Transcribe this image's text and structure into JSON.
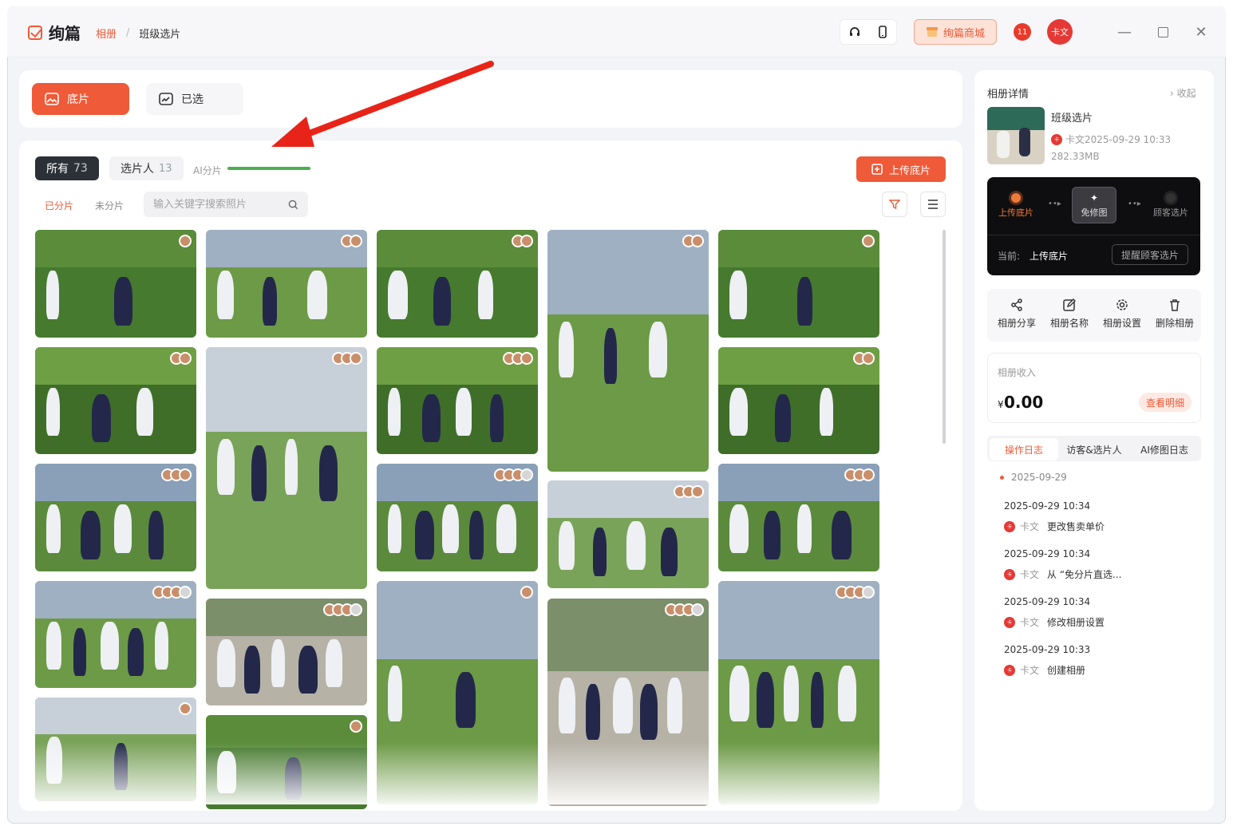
{
  "app": {
    "name": "绚篇",
    "breadcrumb": [
      "相册",
      "班级选片"
    ]
  },
  "titlebar": {
    "shop_label": "绚篇商城",
    "badge_label": "11",
    "user_initials": "卡文"
  },
  "tabs": [
    {
      "label": "底片",
      "active": true
    },
    {
      "label": "已选",
      "active": false
    }
  ],
  "filters": {
    "all_label": "所有",
    "all_count": "73",
    "pickers_label": "选片人",
    "pickers_count": "13",
    "ai_label": "AI分片",
    "sub_tabs": [
      "已分片",
      "未分片"
    ],
    "search_placeholder": "输入关键字搜索照片",
    "upload_label": "上传底片"
  },
  "album": {
    "panel_title": "相册详情",
    "collapse_label": "收起",
    "name": "班级选片",
    "owner_time": "卡文2025-09-29 10:33",
    "size": "282.33MB"
  },
  "workflow": {
    "steps": [
      "上传底片",
      "免修图",
      "顾客选片"
    ],
    "current_label": "当前:",
    "current_value": "上传底片",
    "remind_label": "提醒顾客选片"
  },
  "actions": [
    "相册分享",
    "相册名称",
    "相册设置",
    "删除相册"
  ],
  "income": {
    "label": "相册收入",
    "amount": "0.00",
    "currency": "¥",
    "detail_label": "查看明细"
  },
  "log_tabs": [
    "操作日志",
    "访客&选片人",
    "AI修图日志"
  ],
  "log_date": "2025-09-29",
  "logs": [
    {
      "time": "2025-09-29 10:34",
      "user": "卡文",
      "text": "更改售卖单价"
    },
    {
      "time": "2025-09-29 10:34",
      "user": "卡文",
      "text": "从 “免分片直选..."
    },
    {
      "time": "2025-09-29 10:34",
      "user": "卡文",
      "text": "修改相册设置"
    },
    {
      "time": "2025-09-29 10:33",
      "user": "卡文",
      "text": "创建相册"
    }
  ],
  "colors": {
    "accent": "#ef5a38",
    "dark": "#2c3138",
    "ai_progress": "#4caf50"
  }
}
